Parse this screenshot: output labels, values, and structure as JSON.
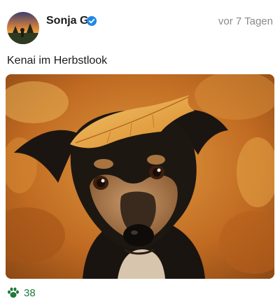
{
  "post": {
    "author": "Sonja G",
    "verified": true,
    "timestamp": "vor 7 Tagen",
    "caption": "Kenai im Herbstlook",
    "image": {
      "icon": "dog-photo"
    },
    "reactions": {
      "icon": "paw-icon",
      "count": "38",
      "color": "#1f7a3c"
    }
  },
  "colors": {
    "verified_badge": "#1e88e5",
    "text_primary": "#1c1c1c",
    "text_secondary": "#8a8a8a"
  }
}
